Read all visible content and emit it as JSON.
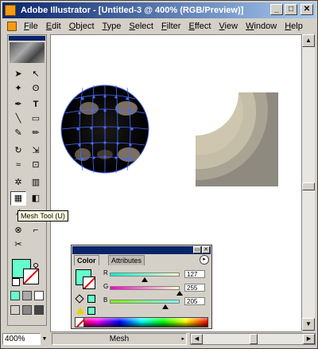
{
  "window": {
    "title": "Adobe Illustrator - [Untitled-3 @ 400% (RGB/Preview)]",
    "minimize_glyph": "_",
    "maximize_glyph": "□",
    "close_glyph": "✕"
  },
  "menubar": {
    "items": [
      "File",
      "Edit",
      "Object",
      "Type",
      "Select",
      "Filter",
      "Effect",
      "View",
      "Window",
      "Help"
    ]
  },
  "toolbox": {
    "tools": [
      {
        "name": "selection-tool-icon",
        "glyph": "➤"
      },
      {
        "name": "direct-selection-tool-icon",
        "glyph": "↖"
      },
      {
        "name": "magic-wand-tool-icon",
        "glyph": "✦"
      },
      {
        "name": "lasso-tool-icon",
        "glyph": "ʘ"
      },
      {
        "name": "pen-tool-icon",
        "glyph": "✒"
      },
      {
        "name": "type-tool-icon",
        "glyph": "T"
      },
      {
        "name": "line-tool-icon",
        "glyph": "╲"
      },
      {
        "name": "rectangle-tool-icon",
        "glyph": "▭"
      },
      {
        "name": "paintbrush-tool-icon",
        "glyph": "✎"
      },
      {
        "name": "pencil-tool-icon",
        "glyph": "✏"
      },
      {
        "name": "rotate-tool-icon",
        "glyph": "↻"
      },
      {
        "name": "scale-tool-icon",
        "glyph": "⇲"
      },
      {
        "name": "warp-tool-icon",
        "glyph": "≈"
      },
      {
        "name": "free-transform-tool-icon",
        "glyph": "⊡"
      },
      {
        "name": "symbol-sprayer-tool-icon",
        "glyph": "✲"
      },
      {
        "name": "graph-tool-icon",
        "glyph": "▥"
      },
      {
        "name": "mesh-tool-icon",
        "glyph": "▦"
      },
      {
        "name": "gradient-tool-icon",
        "glyph": "◧"
      },
      {
        "name": "eyedropper-tool-icon",
        "glyph": "⁄"
      },
      {
        "name": "blend-tool-icon",
        "glyph": "⊗"
      },
      {
        "name": "slice-tool-icon",
        "glyph": "⌐"
      },
      {
        "name": "scissors-tool-icon",
        "glyph": "✂"
      },
      {
        "name": "hand-tool-icon",
        "glyph": "✋"
      },
      {
        "name": "zoom-tool-icon",
        "glyph": "⚲"
      }
    ],
    "tooltip": "Mesh Tool (U)"
  },
  "color_palette": {
    "tabs": [
      "Color",
      "Attributes"
    ],
    "channels": [
      {
        "label": "R",
        "value": "127",
        "position": 0.5
      },
      {
        "label": "G",
        "value": "255",
        "position": 1.0
      },
      {
        "label": "B",
        "value": "205",
        "position": 0.8
      }
    ],
    "menu_glyph": "▸"
  },
  "statusbar": {
    "zoom": "400%",
    "status": "Mesh"
  },
  "colors": {
    "fill": "#66ffcc",
    "titlebar": "#0a246a",
    "mesh_lines": "#4a6cff"
  }
}
